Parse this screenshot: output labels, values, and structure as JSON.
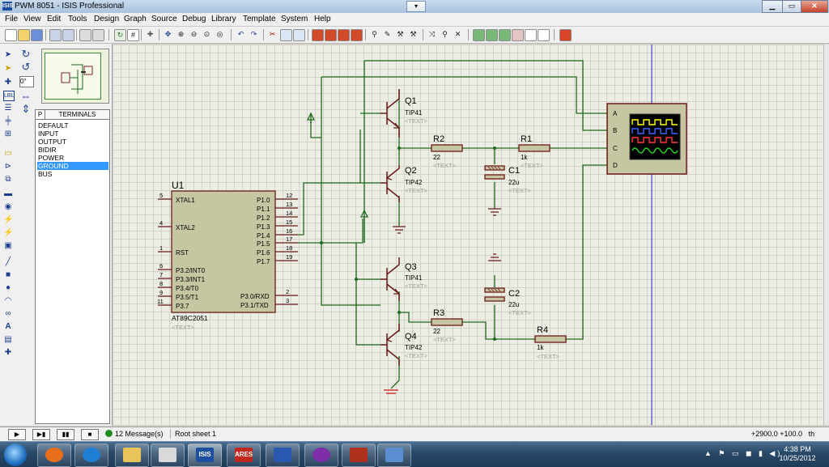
{
  "window": {
    "title": "PWM 8051 - ISIS Professional",
    "app_icon": "ISIS",
    "dropdown": "▾",
    "btn_min": "▁",
    "btn_max": "▭",
    "btn_close": "✕"
  },
  "menu": [
    "File",
    "View",
    "Edit",
    "Tools",
    "Design",
    "Graph",
    "Source",
    "Debug",
    "Library",
    "Template",
    "System",
    "Help"
  ],
  "left_panel": {
    "angle": "0°",
    "p_button": "P",
    "header": "TERMINALS",
    "terminals": [
      "DEFAULT",
      "INPUT",
      "OUTPUT",
      "BIDIR",
      "POWER",
      "GROUND",
      "BUS"
    ],
    "selected": "GROUND"
  },
  "schematic": {
    "u1": {
      "ref": "U1",
      "part": "AT89C2051",
      "text": "<TEXT>",
      "left_pins": [
        {
          "num": "5",
          "name": "XTAL1"
        },
        {
          "num": "4",
          "name": "XTAL2"
        },
        {
          "num": "1",
          "name": "RST"
        },
        {
          "num": "6",
          "name": "P3.2/INT0"
        },
        {
          "num": "7",
          "name": "P3.3/INT1"
        },
        {
          "num": "8",
          "name": "P3.4/T0"
        },
        {
          "num": "9",
          "name": "P3.5/T1"
        },
        {
          "num": "11",
          "name": "P3.7"
        }
      ],
      "right_pins": [
        {
          "num": "12",
          "name": "P1.0"
        },
        {
          "num": "13",
          "name": "P1.1"
        },
        {
          "num": "14",
          "name": "P1.2"
        },
        {
          "num": "15",
          "name": "P1.3"
        },
        {
          "num": "16",
          "name": "P1.4"
        },
        {
          "num": "17",
          "name": "P1.5"
        },
        {
          "num": "18",
          "name": "P1.6"
        },
        {
          "num": "19",
          "name": "P1.7"
        },
        {
          "num": "2",
          "name": "P3.0/RXD"
        },
        {
          "num": "3",
          "name": "P3.1/TXD"
        }
      ]
    },
    "q1": {
      "ref": "Q1",
      "part": "TIP41",
      "text": "<TEXT>"
    },
    "q2": {
      "ref": "Q2",
      "part": "TIP42",
      "text": "<TEXT>"
    },
    "q3": {
      "ref": "Q3",
      "part": "TIP41",
      "text": "<TEXT>"
    },
    "q4": {
      "ref": "Q4",
      "part": "TIP42",
      "text": "<TEXT>"
    },
    "r1": {
      "ref": "R1",
      "value": "1k",
      "text": "<TEXT>"
    },
    "r2": {
      "ref": "R2",
      "value": "22",
      "text": "<TEXT>"
    },
    "r3": {
      "ref": "R3",
      "value": "22",
      "text": "<TEXT>"
    },
    "r4": {
      "ref": "R4",
      "value": "1k",
      "text": "<TEXT>"
    },
    "c1": {
      "ref": "C1",
      "value": "22u",
      "text": "<TEXT>"
    },
    "c2": {
      "ref": "C2",
      "value": "22u",
      "text": "<TEXT>"
    },
    "scope": {
      "channels": [
        "A",
        "B",
        "C",
        "D"
      ],
      "trace_colors": [
        "#ffff00",
        "#3c64ff",
        "#ff3c3c",
        "#28dc28"
      ]
    }
  },
  "status": {
    "messages": "12 Message(s)",
    "sheet": "Root sheet 1",
    "coords": "+2900.0   +100.0",
    "unit": "th"
  },
  "taskbar": {
    "time": "4:38 PM",
    "date": "10/25/2012",
    "ares_label": "ARES",
    "isis_label": "ISIS"
  }
}
